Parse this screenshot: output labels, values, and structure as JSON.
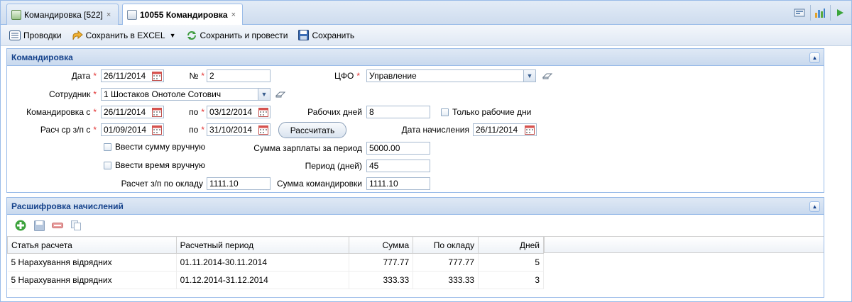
{
  "tabs": [
    {
      "label": "Командировка [522]",
      "active": false
    },
    {
      "label": "10055 Командировка",
      "active": true
    }
  ],
  "tab_close": "×",
  "toolbar": {
    "postings": "Проводки",
    "save_excel": "Сохранить в EXCEL",
    "save_post": "Сохранить и провести",
    "save": "Сохранить"
  },
  "form_section": {
    "title": "Командировка",
    "date_label": "Дата",
    "date_value": "26/11/2014",
    "number_label": "№",
    "number_value": "2",
    "cfo_label": "ЦФО",
    "cfo_value": "Управление",
    "employee_label": "Сотрудник",
    "employee_value": "1 Шостаков Онотоле Сотович",
    "trip_from_label": "Командировка с",
    "trip_from_value": "26/11/2014",
    "trip_to_label": "по",
    "trip_to_value": "03/12/2014",
    "workdays_label": "Рабочих дней",
    "workdays_value": "8",
    "only_workdays_label": "Только рабочие дни",
    "avg_from_label": "Расч ср з/п с",
    "avg_from_value": "01/09/2014",
    "avg_to_label": "по",
    "avg_to_value": "31/10/2014",
    "calc_button": "Рассчитать",
    "accrual_date_label": "Дата начисления",
    "accrual_date_value": "26/11/2014",
    "manual_sum_label": "Ввести сумму вручную",
    "salary_sum_label": "Сумма зарплаты за период",
    "salary_sum_value": "5000.00",
    "manual_time_label": "Ввести время вручную",
    "period_days_label": "Период (дней)",
    "period_days_value": "45",
    "salary_calc_label": "Расчет з/п по окладу",
    "salary_calc_value": "1111.10",
    "trip_sum_label": "Сумма командировки",
    "trip_sum_value": "1111.10",
    "required_mark": "*"
  },
  "grid_section": {
    "title": "Расшифровка начислений",
    "columns": [
      "Статья расчета",
      "Расчетный период",
      "Сумма",
      "По окладу",
      "Дней"
    ],
    "rows": [
      [
        "5 Нарахування відрядних",
        "01.11.2014-30.11.2014",
        "777.77",
        "777.77",
        "5"
      ],
      [
        "5 Нарахування відрядних",
        "01.12.2014-31.12.2014",
        "333.33",
        "333.33",
        "3"
      ]
    ]
  },
  "colors": {
    "header_text": "#15428b",
    "required": "#e23030",
    "border": "#99bbe8"
  }
}
